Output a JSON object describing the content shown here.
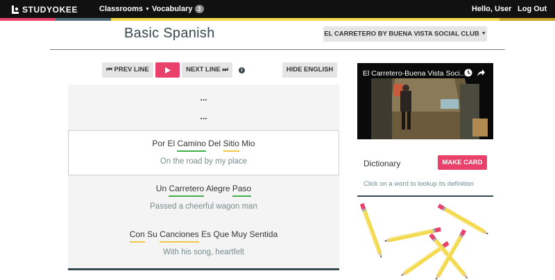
{
  "colors": {
    "accent_pink": "#e9416a",
    "navbar_bg": "#111111",
    "underline_green": "#3fae49",
    "underline_yellow": "#f2c744",
    "dark_slate": "#37474f"
  },
  "navbar": {
    "brand": "STUDYOKEE",
    "classrooms_label": "Classrooms",
    "vocabulary_label": "Vocabulary",
    "vocabulary_count": "3",
    "greeting": "Hello, User",
    "logout_label": "Log Out"
  },
  "header": {
    "title": "Basic Spanish",
    "song_select": "EL CARRETERO BY BUENA VISTA SOCIAL CLUB"
  },
  "controls": {
    "prev_label": "PREV LINE",
    "next_label": "NEXT LINE",
    "hide_english_label": "HIDE ENGLISH",
    "info_glyph": "i"
  },
  "lyrics": {
    "ellipsis_1": "...",
    "ellipsis_2": "...",
    "lines": [
      {
        "spanish": [
          "Por",
          "El",
          "Camino",
          "Del",
          "Sitio",
          "Mio"
        ],
        "english": "On the road by my place",
        "active": true
      },
      {
        "spanish": [
          "Un",
          "Carretero",
          "Alegre",
          "Paso"
        ],
        "english": "Passed a cheerful wagon man",
        "active": false
      },
      {
        "spanish": [
          "Con",
          "Su",
          "Canciones",
          "Es",
          "Que",
          "Muy",
          "Sentida"
        ],
        "english": "With his song, heartfelt",
        "active": false
      }
    ]
  },
  "video": {
    "title": "El Carretero-Buena Vista Soci..."
  },
  "dictionary": {
    "title": "Dictionary",
    "make_card_label": "MAKE CARD",
    "hint": "Click on a word to lookup its definition"
  }
}
